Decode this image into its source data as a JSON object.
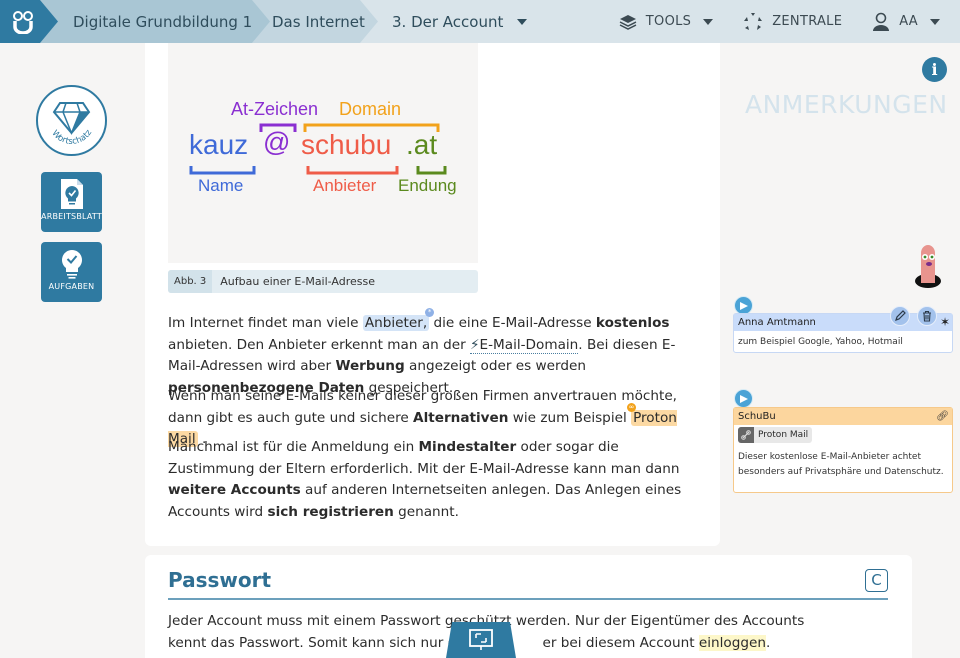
{
  "topbar": {
    "breadcrumbs": [
      {
        "label": "Digitale Grundbildung 1"
      },
      {
        "label": "Das Internet"
      },
      {
        "label": "3. Der Account"
      }
    ],
    "tools_label": "TOOLS",
    "zentrale_label": "ZENTRALE",
    "user_label": "AA"
  },
  "sidebar": {
    "wortschatz_label": "Wortschatz",
    "arbeitsblatt_label": "ARBEITSBLATT",
    "aufgaben_label": "AUFGABEN"
  },
  "figure": {
    "labels": {
      "at_zeichen": "At-Zeichen",
      "domain": "Domain",
      "name_part": "kauz",
      "at": "@",
      "provider_part": "schubu",
      "tld_part": ".at",
      "name": "Name",
      "anbieter": "Anbieter",
      "endung": "Endung"
    },
    "colors": {
      "name": "#3f6ad8",
      "at": "#8a2fd1",
      "domain": "#f2a21b",
      "provider": "#ef5c48",
      "tld": "#5b8a1e"
    },
    "caption_number": "Abb. 3",
    "caption_text": "Aufbau einer E-Mail-Adresse"
  },
  "content": {
    "p1": {
      "t1": "Im Internet findet man viele ",
      "hl": "Anbieter,",
      "t2": " die eine E-Mail-Adresse ",
      "b1": "kostenlos",
      "t3": " anbieten. Den Anbieter erkennt man an der ",
      "link": "E-Mail-Domain",
      "t4": ". Bei diesen E-Mail-Adressen wird aber ",
      "b2": "Werbung",
      "t5": " angezeigt oder es werden ",
      "b3": "personenbezogene Daten",
      "t6": " gespeichert."
    },
    "p2": {
      "t1": "Wenn man seine E-Mails keiner dieser großen Firmen anvertrauen möchte, dann gibt es auch gute und sichere ",
      "b1": "Alternativen",
      "t2": " wie zum Beispiel ",
      "hl": "Proton Mail",
      "t3": " ."
    },
    "p3": {
      "t1": "Manchmal ist für die Anmeldung ein ",
      "b1": "Mindestalter",
      "t2": " oder sogar die Zustimmung der Eltern erforderlich. Mit der E-Mail-Adresse kann man dann ",
      "b2": "weitere Accounts",
      "t3": " auf anderen Internetseiten anlegen. Das Anlegen eines Accounts wird ",
      "b3": "sich registrieren",
      "t4": " genannt."
    }
  },
  "passwort": {
    "title": "Passwort",
    "badge": "C",
    "line1": "Jeder Account muss mit einem Passwort geschützt werden. Nur der Eigentümer des Accounts",
    "line2a": "kennt das Passwort. Somit kann sich nur der ",
    "line2b": "er bei diesem Account ",
    "line2_hl": "einloggen",
    "line2_end": "."
  },
  "annotations": {
    "title": "ANMERKUNGEN",
    "notes": [
      {
        "author": "Anna Amtmann",
        "text": "zum Beispiel Google, Yahoo, Hotmail",
        "color": "#c9dcfa"
      },
      {
        "author": "SchuBu",
        "link_label": "Proton Mail",
        "text": "Dieser kostenlose E-Mail-Anbieter achtet besonders auf Privatsphäre und Datenschutz.",
        "color": "#fcd69e"
      }
    ]
  }
}
